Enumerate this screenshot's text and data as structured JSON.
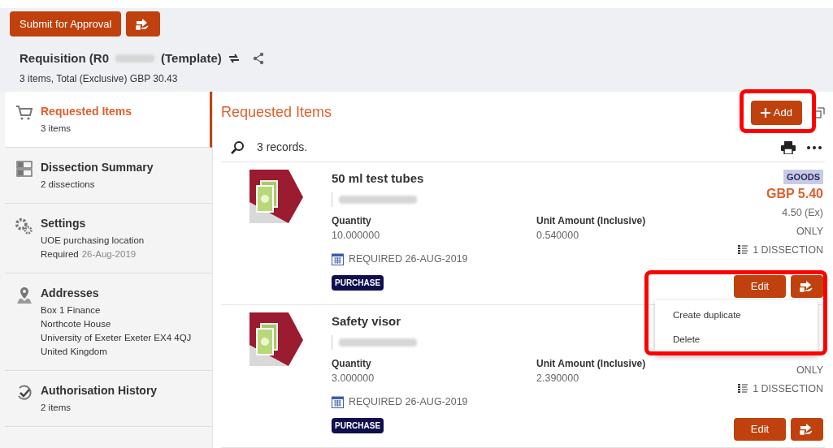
{
  "toolbar": {
    "primary_button": "Submit for Approval"
  },
  "header": {
    "title_start": "Requisition (R0",
    "title_end": "(Template)",
    "summary": "3 items, Total (Exclusive) GBP 30.43"
  },
  "sidebar": {
    "items": [
      {
        "kind": "cart",
        "title": "Requested Items",
        "lines": [
          "3 items"
        ],
        "selected": true
      },
      {
        "kind": "summary",
        "title": "Dissection Summary",
        "lines": [
          "2 dissections"
        ],
        "selected": false
      },
      {
        "kind": "gears",
        "title": "Settings",
        "lines": [
          "UOE purchasing location"
        ],
        "date_label": "Required",
        "date": "26-Aug-2019",
        "selected": false
      },
      {
        "kind": "pin",
        "title": "Addresses",
        "lines": [
          "Box 1 Finance",
          "Northcote House",
          "University of Exeter Exeter EX4 4QJ",
          "United Kingdom"
        ],
        "selected": false
      },
      {
        "kind": "history",
        "title": "Authorisation History",
        "lines": [
          "2 items"
        ],
        "selected": false
      }
    ]
  },
  "panel": {
    "title": "Requested Items",
    "add_button": "Add",
    "records": "3 records."
  },
  "items": [
    {
      "name": "50 ml test tubes",
      "quantity_label": "Quantity",
      "quantity": "10.000000",
      "unit_label": "Unit Amount (Inclusive)",
      "unit": "0.540000",
      "required": "REQUIRED 26-AUG-2019",
      "tag": "PURCHASE",
      "badge": "GOODS",
      "price": "GBP 5.40",
      "ex": "4.50 (Ex)",
      "only": "ONLY",
      "dissection": "1 DISSECTION",
      "edit": "Edit"
    },
    {
      "name": "Safety visor",
      "quantity_label": "Quantity",
      "quantity": "3.000000",
      "unit_label": "Unit Amount (Inclusive)",
      "unit": "2.390000",
      "required": "REQUIRED 26-AUG-2019",
      "tag": "PURCHASE",
      "only": "ONLY",
      "dissection": "1 DISSECTION",
      "edit": "Edit"
    }
  ],
  "menu": {
    "items": [
      "Create duplicate",
      "Delete"
    ]
  }
}
